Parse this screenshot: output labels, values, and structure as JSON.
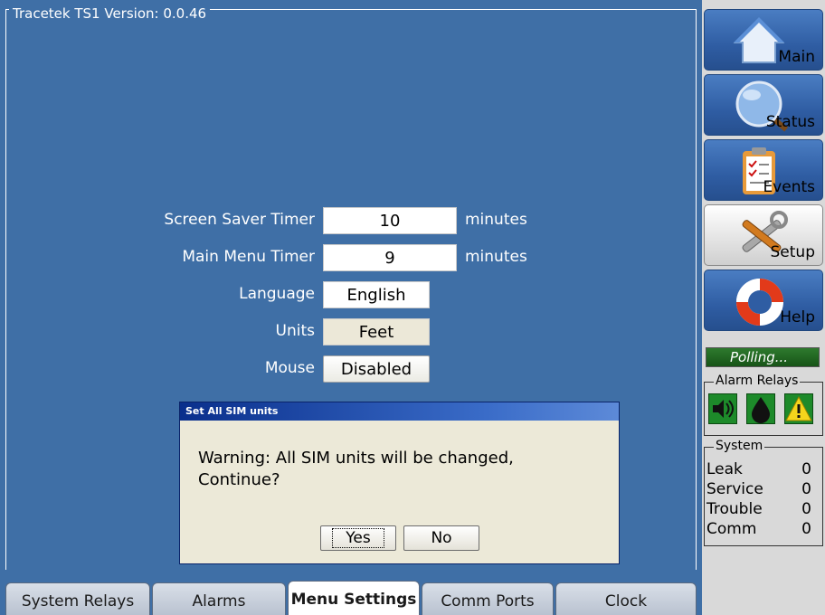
{
  "panel": {
    "title": "Tracetek TS1 Version: 0.0.46"
  },
  "settings": [
    {
      "label": "Screen Saver Timer",
      "value": "10",
      "unit": "minutes"
    },
    {
      "label": "Main Menu Timer",
      "value": "9",
      "unit": "minutes"
    },
    {
      "label": "Language",
      "value": "English"
    },
    {
      "label": "Units",
      "value": "Feet"
    },
    {
      "label": "Mouse",
      "value": "Disabled"
    }
  ],
  "dialog": {
    "title": "Set All SIM units",
    "message": "Warning: All SIM units will be changed, Continue?",
    "yes": "Yes",
    "no": "No"
  },
  "tabs": [
    {
      "label": "System Relays"
    },
    {
      "label": "Alarms"
    },
    {
      "label": "Menu Settings",
      "active": true
    },
    {
      "label": "Comm Ports"
    },
    {
      "label": "Clock"
    }
  ],
  "sidebar": {
    "nav": [
      {
        "label": "Main",
        "icon": "home-icon"
      },
      {
        "label": "Status",
        "icon": "magnifier-icon"
      },
      {
        "label": "Events",
        "icon": "clipboard-icon"
      },
      {
        "label": "Setup",
        "icon": "tools-icon",
        "active": true
      },
      {
        "label": "Help",
        "icon": "lifebuoy-icon"
      }
    ],
    "polling": "Polling...",
    "alarm_relays": {
      "title": "Alarm Relays",
      "icons": [
        "speaker-icon",
        "droplet-icon",
        "warning-icon"
      ]
    },
    "system": {
      "title": "System",
      "rows": [
        {
          "label": "Leak",
          "value": "0"
        },
        {
          "label": "Service",
          "value": "0"
        },
        {
          "label": "Trouble",
          "value": "0"
        },
        {
          "label": "Comm",
          "value": "0"
        }
      ]
    }
  },
  "colors": {
    "panel_bg": "#3f6fa6",
    "nav_blue": "#2f5da3",
    "sidebar_bg": "#d9d9d9",
    "dialog_title": "#0a2f8c",
    "polling_green": "#2e7a2e"
  }
}
